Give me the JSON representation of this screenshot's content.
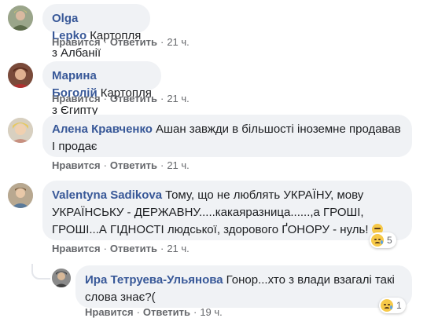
{
  "comments": [
    {
      "author": "Olga Lepko",
      "text": "Картопля з Албанії",
      "like_label": "Нравится",
      "reply_label": "Ответить",
      "time": "21 ч."
    },
    {
      "author": "Марина Боголій",
      "text": "Картопля з Єгипту",
      "like_label": "Нравится",
      "reply_label": "Ответить",
      "time": "21 ч."
    },
    {
      "author": "Алена Кравченко",
      "text": "Ашан завжди в більшості іноземне продавав І продає",
      "like_label": "Нравится",
      "reply_label": "Ответить",
      "time": "21 ч."
    },
    {
      "author": "Valentyna Sadikova",
      "text": "Тому, що не люблять УКРАЇНУ, мову УКРАЇНСЬКУ - ДЕРЖАВНУ.....какаяразница......,а ГРОШІ, ГРОШІ...А ГІДНОСТІ людської, здорового ҐОНОРУ - нуль!",
      "like_label": "Нравится",
      "reply_label": "Ответить",
      "time": "21 ч.",
      "reaction_icon": "sad-emoji-icon",
      "reaction_count": "5"
    },
    {
      "author": "Ира Тетруева-Ульянова",
      "text": "Гонор...хто з влади взагалі такі слова знає?(",
      "like_label": "Нравится",
      "reply_label": "Ответить",
      "time": "19 ч.",
      "reaction_icon": "sad-emoji-icon",
      "reaction_count": "1"
    }
  ],
  "separator": "·",
  "colors": {
    "author": "#385898",
    "bubble": "#f0f2f5",
    "meta": "#65676b"
  }
}
